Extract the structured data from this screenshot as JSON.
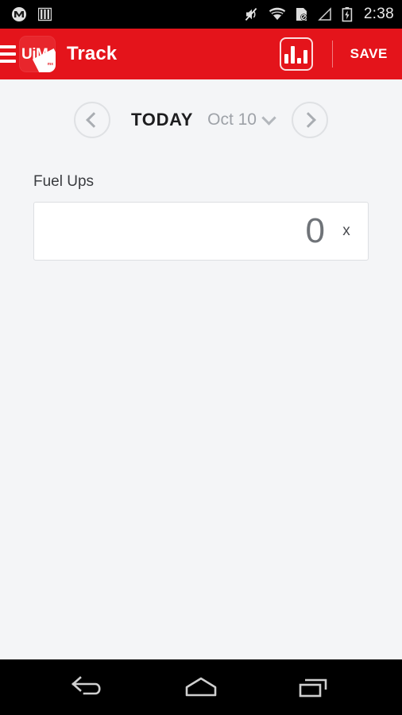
{
  "status_bar": {
    "icons": [
      "motorola-icon",
      "sim-bars-icon",
      "mute-icon",
      "wifi-icon",
      "sd-card-disabled-icon",
      "signal-triangle-icon",
      "battery-charging-icon"
    ],
    "time": "2:38"
  },
  "app_bar": {
    "menu_icon": "hamburger-menu-icon",
    "logo_text": "UiM",
    "logo_sub": "mx",
    "title": "Track",
    "chart_icon": "bar-chart-icon",
    "save_label": "SAVE",
    "background_color": "#e4141b"
  },
  "date_nav": {
    "prev_icon": "chevron-left-icon",
    "next_icon": "chevron-right-icon",
    "today_label": "TODAY",
    "date_value": "Oct 10",
    "dropdown_icon": "chevron-down-icon"
  },
  "form": {
    "field_label": "Fuel Ups",
    "field_value": "0",
    "field_placeholder": "0",
    "clear_label": "x"
  },
  "nav_bar": {
    "back_icon": "back-arrow-icon",
    "home_icon": "home-icon",
    "recents_icon": "recent-apps-icon"
  }
}
